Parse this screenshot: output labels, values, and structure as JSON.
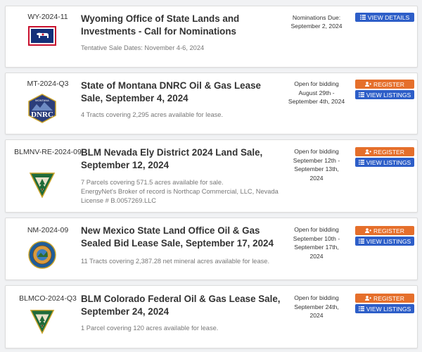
{
  "colors": {
    "register": "#e56f2b",
    "listings": "#2d5ec8",
    "card_bg": "#ffffff",
    "page_bg": "#f1f2f4"
  },
  "icons": {
    "register": "user-plus-icon",
    "listings": "list-icon"
  },
  "sales": [
    {
      "code": "WY-2024-11",
      "logo": "wyoming-flag-logo",
      "title": "Wyoming Office of State Lands and Investments - Call for Nominations",
      "description": [
        "Tentative Sale Dates: November 4-6, 2024"
      ],
      "date_lines": [
        "Nominations Due:",
        "September 2, 2024"
      ],
      "buttons": [
        "VIEW DETAILS"
      ]
    },
    {
      "code": "MT-2024-Q3",
      "logo": "montana-dnrc-logo",
      "logo_text": "DNRC",
      "title": "State of Montana DNRC Oil & Gas Lease Sale, September 4, 2024",
      "description": [
        "4 Tracts covering 2,295 acres available for lease."
      ],
      "date_lines": [
        "Open for bidding",
        "August 29th -",
        "September 4th, 2024"
      ],
      "buttons": [
        "REGISTER",
        "VIEW LISTINGS"
      ]
    },
    {
      "code": "BLMNV-RE-2024-09",
      "logo": "blm-logo",
      "title": "BLM Nevada Ely District 2024 Land Sale, September 12, 2024",
      "description": [
        "7 Parcels covering 571.5 acres available for sale.",
        "EnergyNet's Broker of record is Northcap Commercial, LLC, Nevada License # B.0057269.LLC"
      ],
      "date_lines": [
        "Open for bidding",
        "September 12th -",
        "September 13th, 2024"
      ],
      "buttons": [
        "REGISTER",
        "VIEW LISTINGS"
      ]
    },
    {
      "code": "NM-2024-09",
      "logo": "new-mexico-seal-logo",
      "title": "New Mexico State Land Office Oil & Gas Sealed Bid Lease Sale, September 17, 2024",
      "description": [
        "11 Tracts covering 2,387.28 net mineral acres available for lease."
      ],
      "date_lines": [
        "Open for bidding",
        "September 10th -",
        "September 17th, 2024"
      ],
      "buttons": [
        "REGISTER",
        "VIEW LISTINGS"
      ]
    },
    {
      "code": "BLMCO-2024-Q3",
      "logo": "blm-logo",
      "title": "BLM Colorado Federal Oil & Gas Lease Sale, September 24, 2024",
      "description": [
        "1 Parcel covering 120 acres available for lease."
      ],
      "date_lines": [
        "Open for bidding",
        "September 24th, 2024"
      ],
      "buttons": [
        "REGISTER",
        "VIEW LISTINGS"
      ]
    }
  ]
}
